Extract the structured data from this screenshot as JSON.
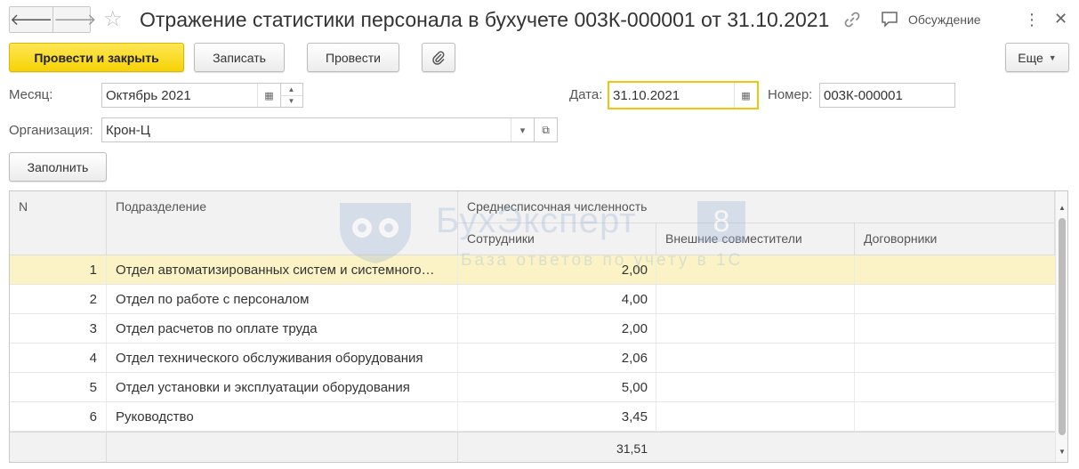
{
  "window": {
    "title": "Отражение статистики персонала в бухучете 003К-000001 от 31.10.2021",
    "discussion_label": "Обсуждение"
  },
  "toolbar": {
    "post_close_label": "Провести и закрыть",
    "save_label": "Записать",
    "post_label": "Провести",
    "more_label": "Еще",
    "fill_label": "Заполнить"
  },
  "form": {
    "month_label": "Месяц:",
    "month_value": "Октябрь 2021",
    "date_label": "Дата:",
    "date_value": "31.10.2021",
    "number_label": "Номер:",
    "number_value": "003К-000001",
    "org_label": "Организация:",
    "org_value": "Крон-Ц"
  },
  "table": {
    "headers": {
      "n": "N",
      "department": "Подразделение",
      "avg_headcount": "Среднесписочная численность",
      "employees": "Сотрудники",
      "external": "Внешние совместители",
      "contractors": "Договорники"
    },
    "rows": [
      {
        "n": "1",
        "department": "Отдел автоматизированных систем и системного…",
        "employees": "2,00"
      },
      {
        "n": "2",
        "department": "Отдел по работе с персоналом",
        "employees": "4,00"
      },
      {
        "n": "3",
        "department": "Отдел расчетов по оплате труда",
        "employees": "2,00"
      },
      {
        "n": "4",
        "department": "Отдел технического обслуживания оборудования",
        "employees": "2,06"
      },
      {
        "n": "5",
        "department": "Отдел установки и эксплуатации оборудования",
        "employees": "5,00"
      },
      {
        "n": "6",
        "department": "Руководство",
        "employees": "3,45"
      }
    ],
    "total_employees": "31,51"
  },
  "watermark": {
    "title": "БухЭксперт",
    "badge": "8",
    "subtitle": "База ответов по учету в 1С"
  },
  "colors": {
    "primary_button": "#f6d305",
    "selected_row": "#fbf3c6",
    "focus_border": "#f1c40f"
  }
}
